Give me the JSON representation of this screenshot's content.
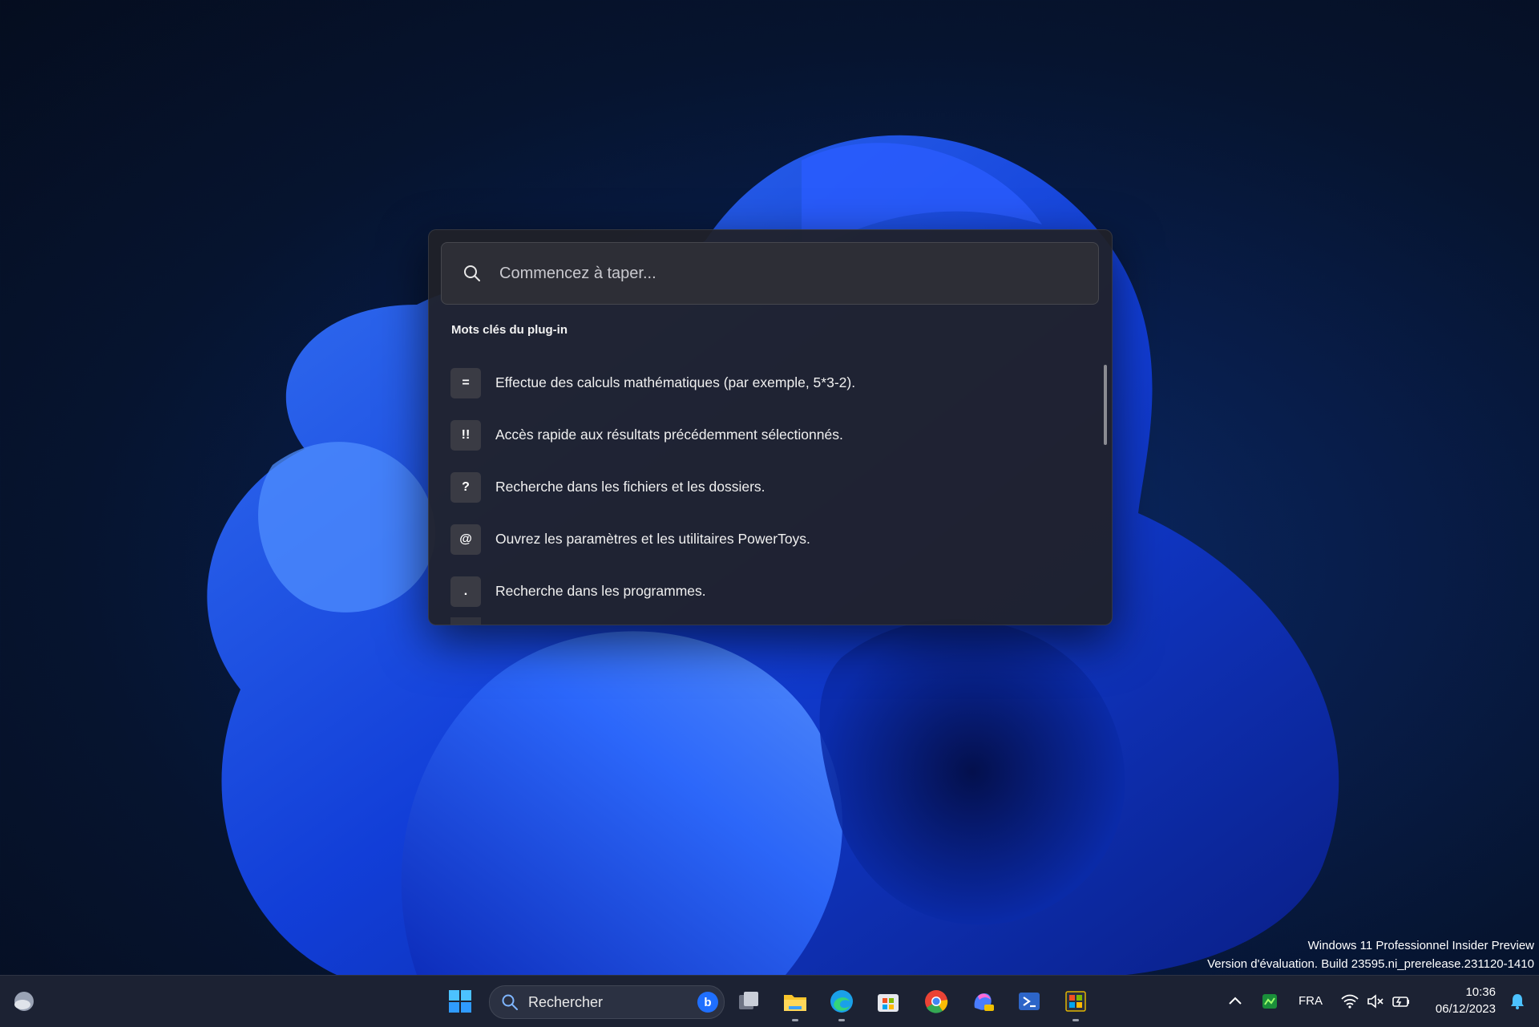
{
  "launcher": {
    "search_placeholder": "Commencez à taper...",
    "section_title": "Mots clés du plug-in",
    "items": [
      {
        "key": "=",
        "description": "Effectue des calculs mathématiques (par exemple, 5*3-2)."
      },
      {
        "key": "!!",
        "description": "Accès rapide aux résultats précédemment sélectionnés."
      },
      {
        "key": "?",
        "description": "Recherche dans les fichiers et les dossiers."
      },
      {
        "key": "@",
        "description": "Ouvrez les paramètres et les utilitaires PowerToys."
      },
      {
        "key": ".",
        "description": "Recherche dans les programmes."
      }
    ]
  },
  "watermark": {
    "line1": "Windows 11 Professionnel Insider Preview",
    "line2": "Version d'évaluation. Build 23595.ni_prerelease.231120-1410"
  },
  "taskbar": {
    "search_label": "Rechercher",
    "language": "FRA",
    "time": "10:36",
    "date": "06/12/2023",
    "icons": [
      "weather-icon",
      "windows-start-icon",
      "task-view-icon",
      "file-explorer-icon",
      "edge-icon",
      "store-icon",
      "chrome-icon",
      "copilot-pre-icon",
      "terminal-icon",
      "powertoys-icon"
    ]
  },
  "colors": {
    "launcher_bg": "#202128",
    "accent": "#0067c0",
    "wallpaper_blue": "#1a4bff"
  }
}
